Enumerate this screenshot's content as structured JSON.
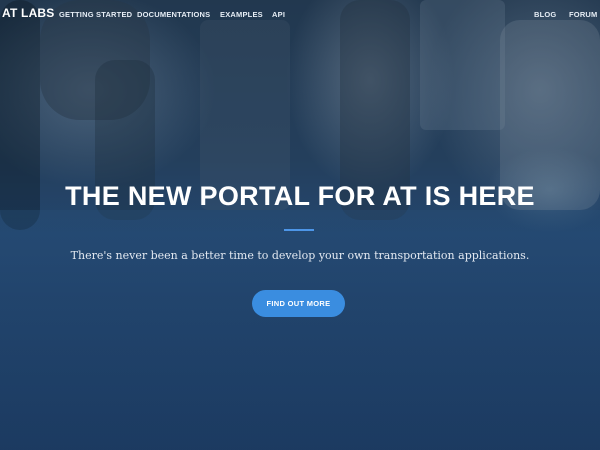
{
  "nav": {
    "brand": "AT LABS",
    "links": [
      "GETTING STARTED",
      "DOCUMENTATIONS",
      "EXAMPLES",
      "API"
    ],
    "right_links": [
      "BLOG",
      "FORUM"
    ]
  },
  "hero": {
    "title": "THE NEW PORTAL FOR AT IS HERE",
    "subtitle": "There's never been a better time to develop your own transportation applications.",
    "cta_label": "FIND OUT MORE"
  },
  "colors": {
    "accent": "#3a8de0",
    "overlay": "#1b3556"
  }
}
